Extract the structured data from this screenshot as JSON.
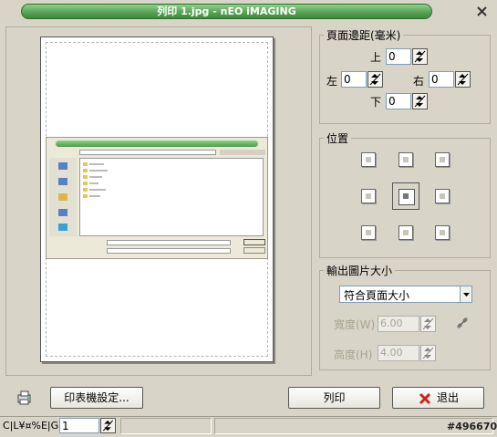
{
  "window": {
    "title": "列印 1.jpg - nEO iMAGING"
  },
  "margins": {
    "title": "頁面邊距(毫米)",
    "top_label": "上",
    "top_value": "0",
    "left_label": "左",
    "left_value": "0",
    "right_label": "右",
    "right_value": "0",
    "bottom_label": "下",
    "bottom_value": "0"
  },
  "position": {
    "title": "位置",
    "selected": "center"
  },
  "output_size": {
    "title": "輸出圖片大小",
    "mode": "符合頁面大小",
    "width_label": "寬度(W)",
    "width_value": "6.00",
    "height_label": "高度(H)",
    "height_value": "4.00"
  },
  "buttons": {
    "printer_setup": "印表機設定...",
    "print": "列印",
    "exit": "退出"
  },
  "statusbar": {
    "page_label": "C|L¥¤%E|G",
    "page_value": "1",
    "watermark": "#496670"
  },
  "colors": {
    "title_bar": "#5aa458",
    "window_bg": "#d8d4c8",
    "exit_x": "#d0201a"
  }
}
